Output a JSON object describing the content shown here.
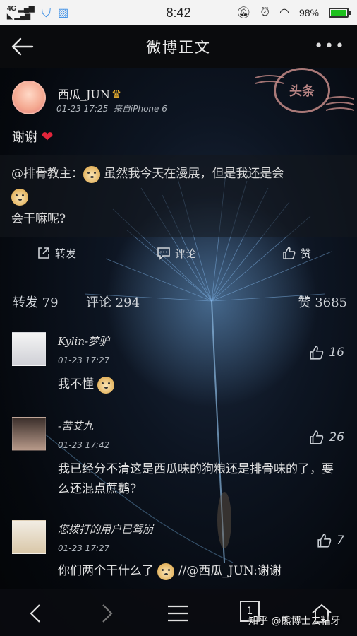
{
  "status_bar": {
    "network": "4G",
    "time": "8:42",
    "battery_percent": "98%",
    "battery_level": 0.98
  },
  "header": {
    "title": "微博正文"
  },
  "post": {
    "author": "西瓜_JUN",
    "time": "01-23 17:25",
    "source": "来自iPhone 6",
    "stamp_text": "头条",
    "text": "谢谢",
    "repost_mention": "@排骨教主",
    "repost_text_a": "虽然我今天在漫展，但是我还是会",
    "repost_text_b": "会干嘛呢?",
    "actions": {
      "repost": "转发",
      "comment": "评论",
      "like": "赞"
    },
    "counts": {
      "repost": "转发 79",
      "comment": "评论 294",
      "like": "赞 3685"
    }
  },
  "comments": [
    {
      "name": "Kylin-梦驴",
      "time": "01-23 17:27",
      "text": "我不懂",
      "likes": "16"
    },
    {
      "name": "-苦艾九",
      "time": "01-23 17:42",
      "text": "我已经分不清这是西瓜味的狗粮还是排骨味的了，要么还混点蔗鹅?",
      "likes": "26"
    },
    {
      "name": "您拨打的用户已驾崩",
      "time": "01-23 17:27",
      "text_a": "你们两个干什么了",
      "text_b": "//@西瓜_JUN:谢谢",
      "likes": "7"
    }
  ],
  "bottom_bar": {
    "tab_count": "1",
    "watermark": "知乎 @熊博士去粘牙"
  },
  "colors": {
    "heart": "#e3253b",
    "battery": "#1ec11e",
    "stamp": "#c58b88"
  }
}
